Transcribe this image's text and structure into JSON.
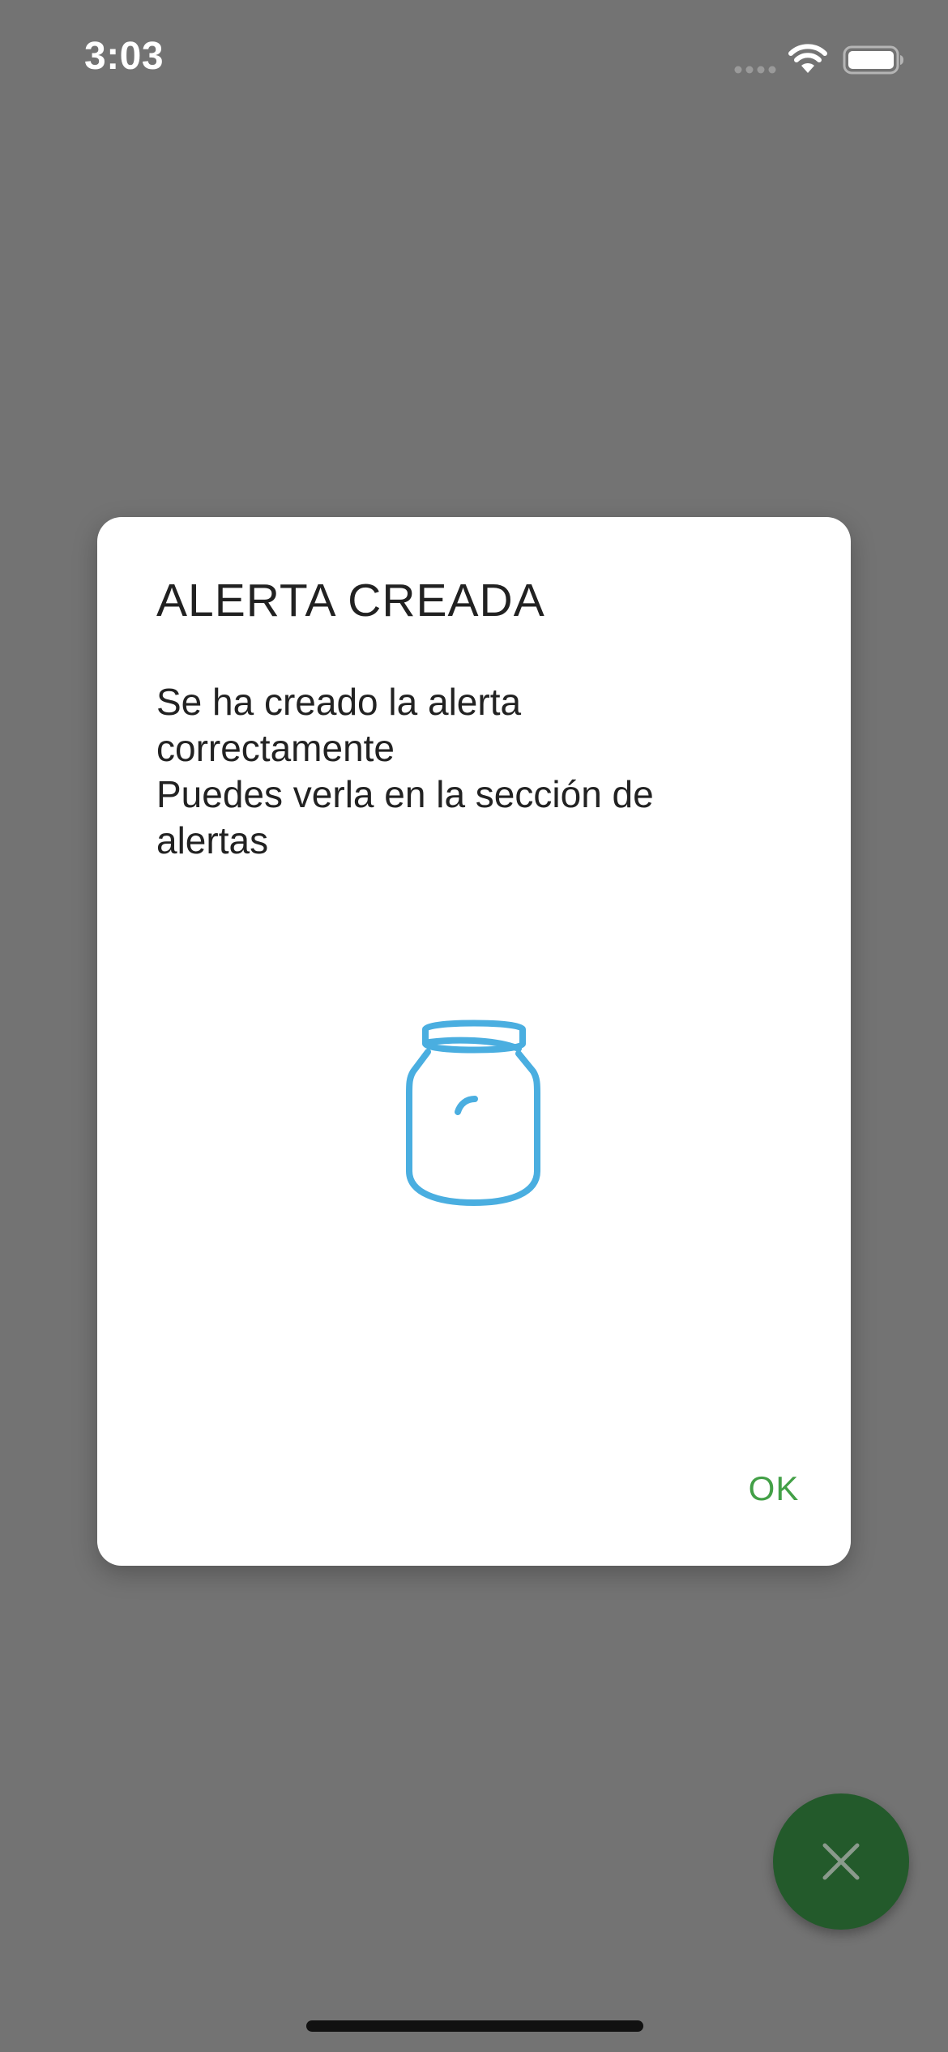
{
  "status_bar": {
    "time": "3:03",
    "icons": [
      "signal-icon",
      "wifi-icon",
      "battery-icon"
    ]
  },
  "dialog": {
    "title": "ALERTA CREADA",
    "message": "Se ha creado la alerta\ncorrectamente\nPuedes verla en la sección de\nalertas",
    "icon": "jar-icon",
    "ok_label": "OK"
  },
  "fab": {
    "icon": "close-icon"
  },
  "colors": {
    "overlay_background": "#737373",
    "dialog_background": "#ffffff",
    "accent_green": "#43a047",
    "fab_background": "#235a2b",
    "icon_blue": "#4aaee0"
  }
}
